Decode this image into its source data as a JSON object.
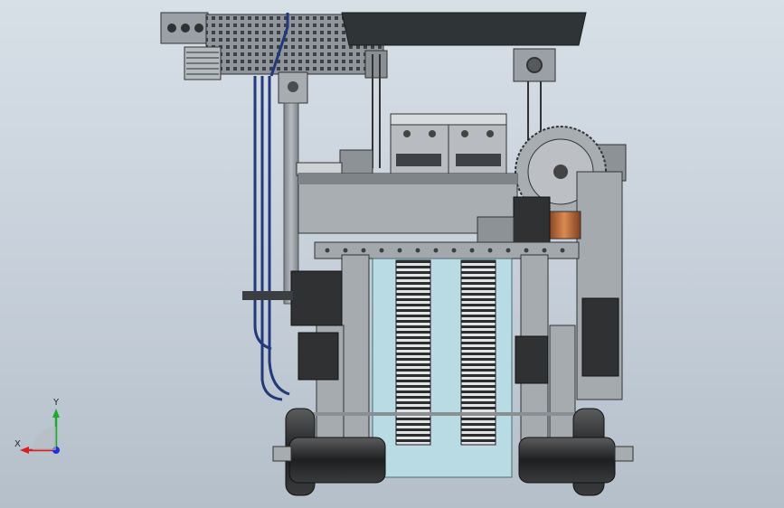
{
  "window": {
    "type": "3d-cad-viewport",
    "background": "#cfd8e1"
  },
  "model": {
    "description_visible": false,
    "colors": {
      "frame_steel": "#9aa0a6",
      "dark_steel": "#55595d",
      "tray": "#3b3f42",
      "cable_blue": "#233a7a",
      "panel_blue": "#b9dbe3",
      "motor_dark": "#2f3133",
      "copper": "#b8683a",
      "tire": "#232425"
    }
  },
  "triad": {
    "x_label": "X",
    "y_label": "Y",
    "x_color": "#d42222",
    "y_color": "#1fa82e",
    "z_color": "#2230d6"
  }
}
